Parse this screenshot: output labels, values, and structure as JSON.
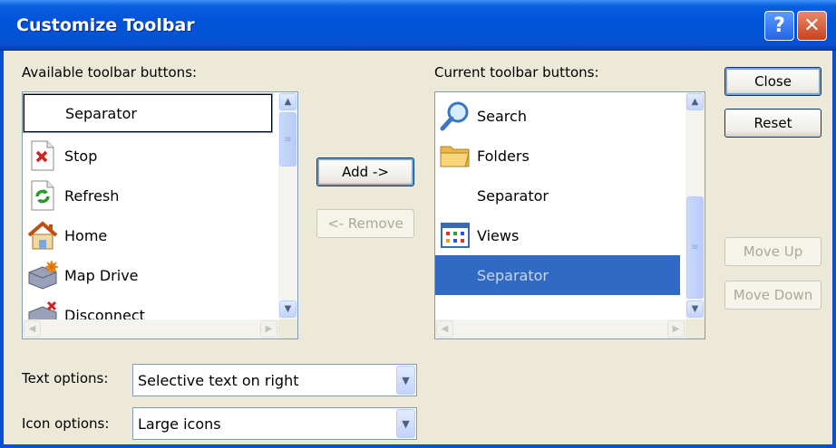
{
  "window": {
    "title": "Customize Toolbar",
    "help_glyph": "?",
    "close_glyph": "✕"
  },
  "available": {
    "label": "Available toolbar buttons:",
    "items": [
      {
        "label": "Separator",
        "icon": "none"
      },
      {
        "label": "Stop",
        "icon": "stop-icon"
      },
      {
        "label": "Refresh",
        "icon": "refresh-icon"
      },
      {
        "label": "Home",
        "icon": "home-icon"
      },
      {
        "label": "Map Drive",
        "icon": "map-drive-icon"
      },
      {
        "label": "Disconnect",
        "icon": "disconnect-icon"
      }
    ]
  },
  "current": {
    "label": "Current toolbar buttons:",
    "items": [
      {
        "label": "Search",
        "icon": "search-icon"
      },
      {
        "label": "Folders",
        "icon": "folders-icon"
      },
      {
        "label": "Separator",
        "icon": "none"
      },
      {
        "label": "Views",
        "icon": "views-icon"
      },
      {
        "label": "Separator",
        "icon": "none",
        "selected": true
      }
    ]
  },
  "buttons": {
    "add": "Add ->",
    "remove": "<- Remove",
    "close": "Close",
    "reset": "Reset",
    "move_up": "Move Up",
    "move_down": "Move Down"
  },
  "text_options": {
    "label": "Text options:",
    "value": "Selective text on right"
  },
  "icon_options": {
    "label": "Icon options:",
    "value": "Large icons"
  },
  "colors": {
    "title_bar": "#0254d8",
    "selection": "#316ac5",
    "dialog_bg": "#ece9d8"
  }
}
